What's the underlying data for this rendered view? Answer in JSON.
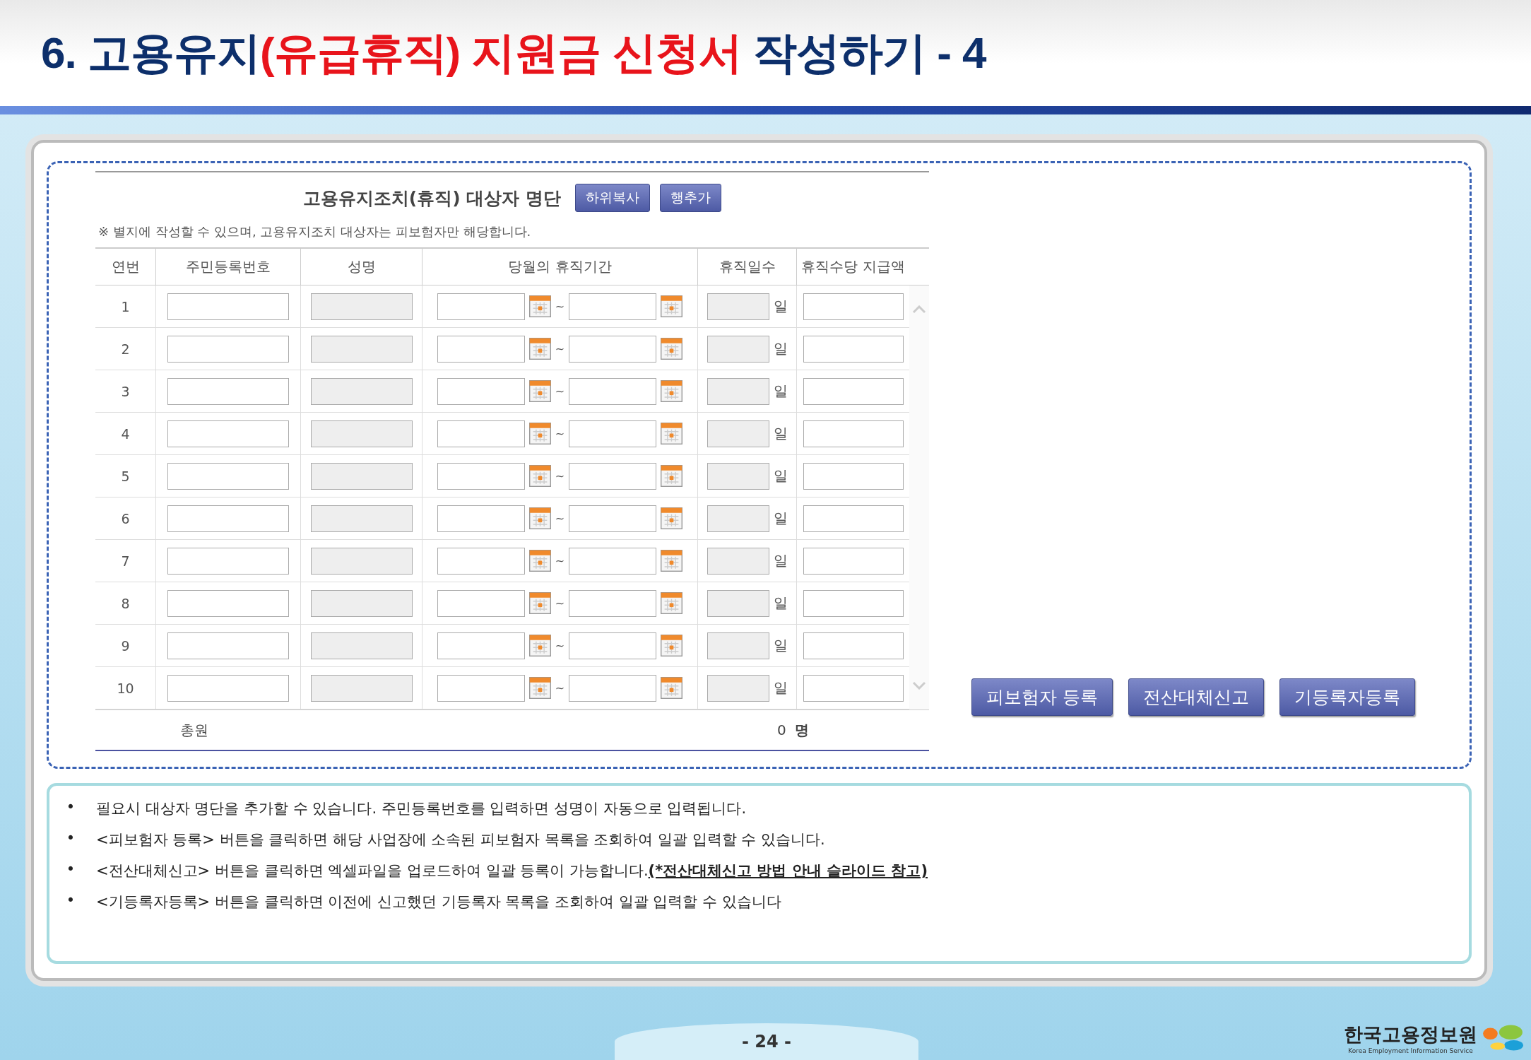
{
  "title_parts": [
    {
      "text": "6. 고용유지",
      "color": "#0d2f6b"
    },
    {
      "text": "(유급휴직) 지원금 신청서",
      "color": "#e8141b"
    },
    {
      "text": " 작성하기 - 4",
      "color": "#0d2f6b"
    }
  ],
  "form": {
    "heading": "고용유지조치(휴직) 대상자 명단",
    "heading_buttons": [
      "하위복사",
      "행추가"
    ],
    "note": "※ 별지에 작성할 수 있으며, 고용유지조치 대상자는 피보험자만 해당합니다.",
    "columns": [
      "연번",
      "주민등록번호",
      "성명",
      "당월의 휴직기간",
      "휴직일수",
      "휴직수당 지급액"
    ],
    "rows": [
      {
        "no": "1",
        "separator": "~",
        "unit": "일"
      },
      {
        "no": "2",
        "separator": "~",
        "unit": "일"
      },
      {
        "no": "3",
        "separator": "~",
        "unit": "일"
      },
      {
        "no": "4",
        "separator": "~",
        "unit": "일"
      },
      {
        "no": "5",
        "separator": "~",
        "unit": "일"
      },
      {
        "no": "6",
        "separator": "~",
        "unit": "일"
      },
      {
        "no": "7",
        "separator": "~",
        "unit": "일"
      },
      {
        "no": "8",
        "separator": "~",
        "unit": "일"
      },
      {
        "no": "9",
        "separator": "~",
        "unit": "일"
      },
      {
        "no": "10",
        "separator": "~",
        "unit": "일"
      }
    ],
    "total": {
      "label": "총원",
      "value": "0",
      "unit": "명"
    },
    "action_buttons": [
      "피보험자 등록",
      "전산대체신고",
      "기등록자등록"
    ]
  },
  "notes": [
    "필요시 대상자 명단을 추가할 수 있습니다. 주민등록번호를 입력하면 성명이 자동으로 입력됩니다.",
    "<피보험자 등록> 버튼을 클릭하면 해당 사업장에 소속된 피보험자 목록을 조회하여 일괄 입력할 수 있습니다.",
    "<전산대체신고> 버튼을 클릭하면 엑셀파일을 업로드하여 일괄 등록이 가능합니다.**(*전산대체신고 방법 안내 슬라이드 참고)**",
    "<기등록자등록> 버튼을 클릭하면 이전에 신고했던 기등록자 목록을 조회하여 일괄 입력할 수 있습니다"
  ],
  "bullet": "•",
  "page_number": "- 24 -",
  "logo": {
    "name": "한국고용정보원",
    "subtitle": "Korea Employment Information Service"
  }
}
